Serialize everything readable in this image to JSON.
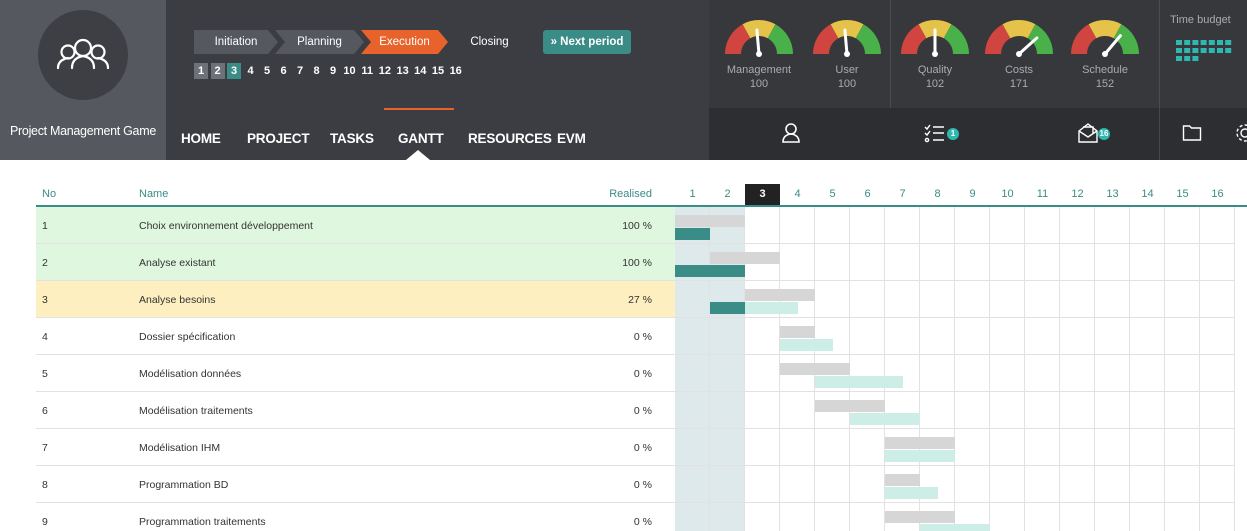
{
  "app": {
    "name": "Project Management Game"
  },
  "phases": [
    {
      "label": "Initiation",
      "color": "#55585e"
    },
    {
      "label": "Planning",
      "color": "#55585e"
    },
    {
      "label": "Execution",
      "color": "#e8632b"
    },
    {
      "label": "Closing",
      "color": "#3b3d42"
    }
  ],
  "next_period_label": "Next period",
  "periods": [
    "1",
    "2",
    "3",
    "4",
    "5",
    "6",
    "7",
    "8",
    "9",
    "10",
    "11",
    "12",
    "13",
    "14",
    "15",
    "16"
  ],
  "current_period": 3,
  "gauges": [
    {
      "name": "Management",
      "value": "100"
    },
    {
      "name": "User",
      "value": "100"
    },
    {
      "name": "Quality",
      "value": "102"
    },
    {
      "name": "Costs",
      "value": "171"
    },
    {
      "name": "Schedule",
      "value": "152"
    }
  ],
  "time_budget_label": "Time budget",
  "nav": [
    "HOME",
    "PROJECT",
    "TASKS",
    "GANTT",
    "RESOURCES",
    "EVM"
  ],
  "active_nav": "GANTT",
  "badges": {
    "tasks": "1",
    "messages": "16"
  },
  "table": {
    "headers": {
      "no": "No",
      "name": "Name",
      "realised": "Realised"
    },
    "rows": [
      {
        "no": "1",
        "name": "Choix environnement développement",
        "realised": "100 %",
        "status": "done"
      },
      {
        "no": "2",
        "name": "Analyse existant",
        "realised": "100 %",
        "status": "done"
      },
      {
        "no": "3",
        "name": "Analyse besoins",
        "realised": "27 %",
        "status": "progress"
      },
      {
        "no": "4",
        "name": "Dossier spécification",
        "realised": "0 %",
        "status": "todo"
      },
      {
        "no": "5",
        "name": "Modélisation données",
        "realised": "0 %",
        "status": "todo"
      },
      {
        "no": "6",
        "name": "Modélisation traitements",
        "realised": "0 %",
        "status": "todo"
      },
      {
        "no": "7",
        "name": "Modélisation IHM",
        "realised": "0 %",
        "status": "todo"
      },
      {
        "no": "8",
        "name": "Programmation BD",
        "realised": "0 %",
        "status": "todo"
      },
      {
        "no": "9",
        "name": "Programmation traitements",
        "realised": "0 %",
        "status": "todo"
      }
    ]
  },
  "colors": {
    "accent": "#3a8c86",
    "done_row": "#dff7df",
    "progress_row": "#fdefc0",
    "planned_bar": "#d6d6d6",
    "actual_bar": "#3a8c86",
    "forecast_bar": "#cdeee7",
    "past_column": "#dde9ea"
  }
}
